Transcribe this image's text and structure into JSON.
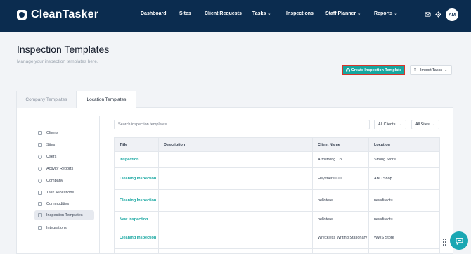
{
  "header": {
    "brand": "CleanTasker",
    "nav": [
      {
        "label": "Dashboard",
        "dropdown": false
      },
      {
        "label": "Sites",
        "dropdown": false
      },
      {
        "label": "Client Requests",
        "dropdown": false
      },
      {
        "label": "Tasks",
        "dropdown": true
      },
      {
        "label": "Inspections",
        "dropdown": false
      },
      {
        "label": "Staff Planner",
        "dropdown": true
      },
      {
        "label": "Reports",
        "dropdown": true
      }
    ],
    "icons": [
      "mail-icon",
      "gear-icon"
    ],
    "avatar_initials": "AM"
  },
  "page": {
    "title": "Inspection Templates",
    "subtitle": "Manage your inspection templates here.",
    "create_button": "Create Inspection Template",
    "import_button": "Import Tasks"
  },
  "tabs": [
    "Company Templates",
    "Location Templates"
  ],
  "active_tab": "Location Templates",
  "sidebar": {
    "items": [
      {
        "label": "Clients",
        "icon": "building-icon"
      },
      {
        "label": "Sites",
        "icon": "site-icon"
      },
      {
        "label": "Users",
        "icon": "users-icon"
      },
      {
        "label": "Activity Reports",
        "icon": "activity-icon"
      },
      {
        "label": "Company",
        "icon": "company-icon"
      },
      {
        "label": "Task Allocations",
        "icon": "calendar-icon"
      },
      {
        "label": "Commodities",
        "icon": "box-icon"
      },
      {
        "label": "Inspection Templates",
        "icon": "list-icon"
      },
      {
        "label": "Integrations",
        "icon": "plug-icon"
      }
    ],
    "active": "Inspection Templates"
  },
  "filters": {
    "search_placeholder": "Search inspection templates...",
    "clients": "All Clients",
    "sites": "All Sites"
  },
  "table": {
    "columns": [
      "Title",
      "Description",
      "Client Name",
      "Location"
    ],
    "rows": [
      {
        "title": "Inspection",
        "description": "",
        "client": "Armstrong Co.",
        "location": "Strong Store"
      },
      {
        "title": "Cleaning Inspection",
        "description": "",
        "client": "Hey there CO.",
        "location": "ABC Shop"
      },
      {
        "title": "Cleaning Inspection",
        "description": "",
        "client": "hellotere",
        "location": "newdirectu"
      },
      {
        "title": "New Inspection",
        "description": "",
        "client": "hellotere",
        "location": "newdirectu"
      },
      {
        "title": "Cleaning Inspection",
        "description": "",
        "client": "Wreckless Writing Stationary",
        "location": "WWS Store"
      }
    ]
  },
  "colors": {
    "header_bg": "#0b2c4f",
    "accent": "#16a6a0",
    "highlight_border": "#d9342b",
    "chat_button": "#1aa7b3"
  }
}
